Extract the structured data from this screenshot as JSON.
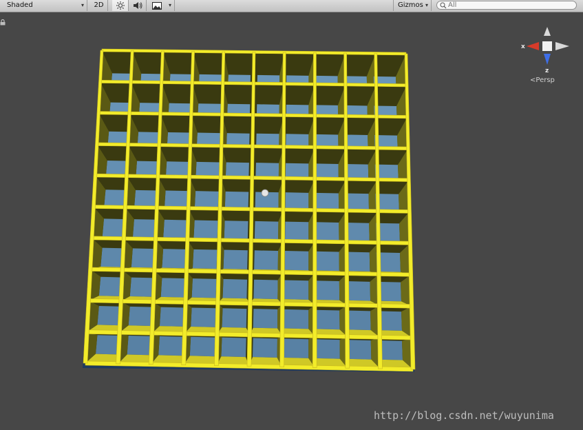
{
  "toolbar": {
    "draw_mode": "Shaded",
    "mode_2d": "2D",
    "lighting_icon": "sun-icon",
    "audio_icon": "speaker-icon",
    "effects_icon": "image-icon",
    "gizmos_label": "Gizmos",
    "search_placeholder": "All"
  },
  "gizmo": {
    "x_label": "x",
    "z_label": "z",
    "projection_label": "Persp",
    "x_color": "#d63b2a",
    "y_color": "#d9d9d9",
    "z_color": "#3e6ee8"
  },
  "scene": {
    "grid_rows": 10,
    "grid_cols": 10,
    "wall_color": "#f2ec2a",
    "floor_color": "#1f3f64",
    "background_color": "#474747"
  },
  "watermark": "http://blog.csdn.net/wuyunima"
}
